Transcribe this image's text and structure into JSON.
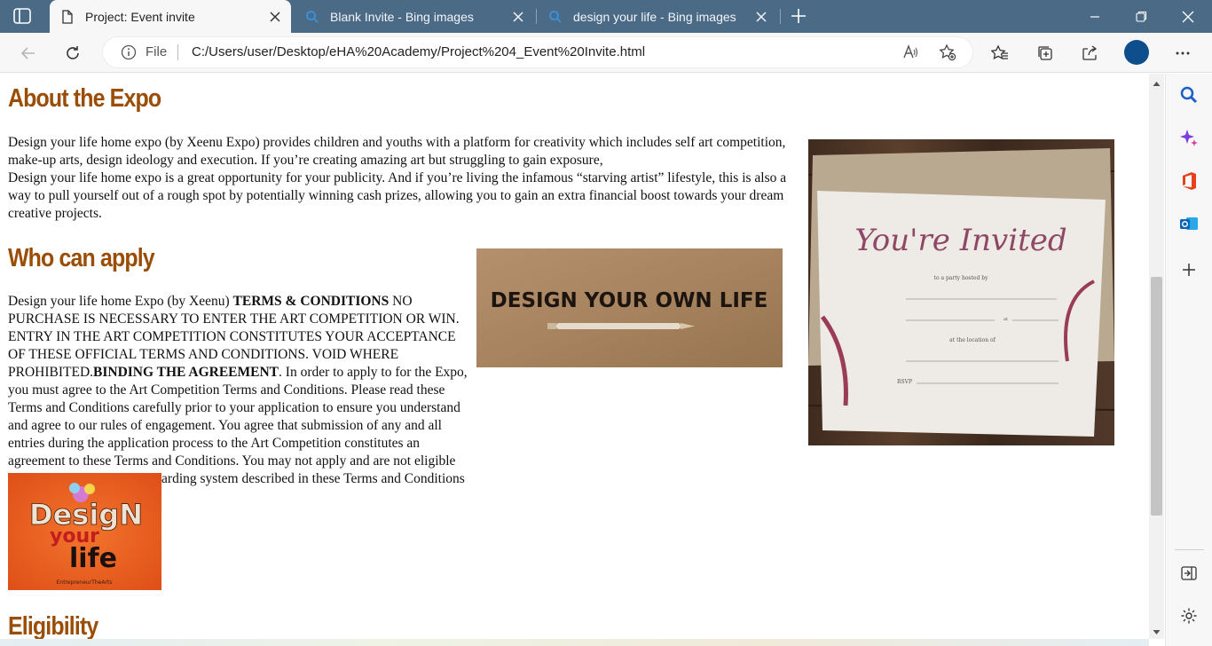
{
  "tabs": [
    {
      "title": "Project: Event invite",
      "active": true
    },
    {
      "title": "Blank Invite - Bing images",
      "active": false
    },
    {
      "title": "design your life - Bing images",
      "active": false
    }
  ],
  "address_bar": {
    "scheme_label": "File",
    "url": "C:/Users/user/Desktop/eHA%20Academy/Project%204_Event%20Invite.html"
  },
  "page": {
    "about": {
      "heading": "About the Expo",
      "body": "Design your life home expo (by Xeenu Expo) provides children and youths with a platform for creativity which includes self art competition, make-up arts, design ideology and execution. If you’re creating amazing art but struggling to gain exposure,",
      "body2": "Design your life home expo is a great opportunity for your publicity. And if you’re living the infamous “starving artist” lifestyle, this is also a way to pull yourself out of a rough spot by potentially winning cash prizes, allowing you to gain an extra financial boost towards your dream creative projects."
    },
    "who": {
      "heading": "Who can apply",
      "lead": "Design your life home Expo (by Xeenu)",
      "terms_label": "TERMS & CONDITIONS",
      "terms_text": "NO PURCHASE IS NECESSARY TO ENTER THE ART COMPETITION OR WIN. ENTRY IN THE ART COMPETITION CONSTITUTES YOUR ACCEPTANCE OF THESE OFFICIAL TERMS AND CONDITIONS. VOID WHERE PROHIBITED.",
      "binding_label": "BINDING THE AGREEMENT",
      "binding_text": ". In order to apply to for the Expo, you must agree to the Art Competition Terms and Conditions. Please read these Terms and Conditions carefully prior to your application to ensure you understand and agree to our rules of engagement. You agree that submission of any and all entries during the application process to the Art Competition constitutes an agreement to these Terms and Conditions. You may not apply and are not eligible for the Art Competition rewarding system described in these Terms and Conditions unless you agree to them."
    },
    "images": {
      "invite_card": {
        "line1": "You're Invited",
        "sub": "to a party hosted by",
        "at": "at",
        "loc": "at the location of",
        "rsvp": "RSVP"
      },
      "own_life": {
        "text": "DESIGN YOUR OWN LIFE"
      },
      "dyl_logo": {
        "line1": "DesigN",
        "line2": "your",
        "line3": "life",
        "tag": "EntrepreneurTheArts"
      }
    },
    "eligibility": {
      "heading": "Eligibility"
    }
  },
  "colors": {
    "heading": "#9a4d05",
    "tabbar": "#4a6a86",
    "accent": "#0e4e8c"
  }
}
